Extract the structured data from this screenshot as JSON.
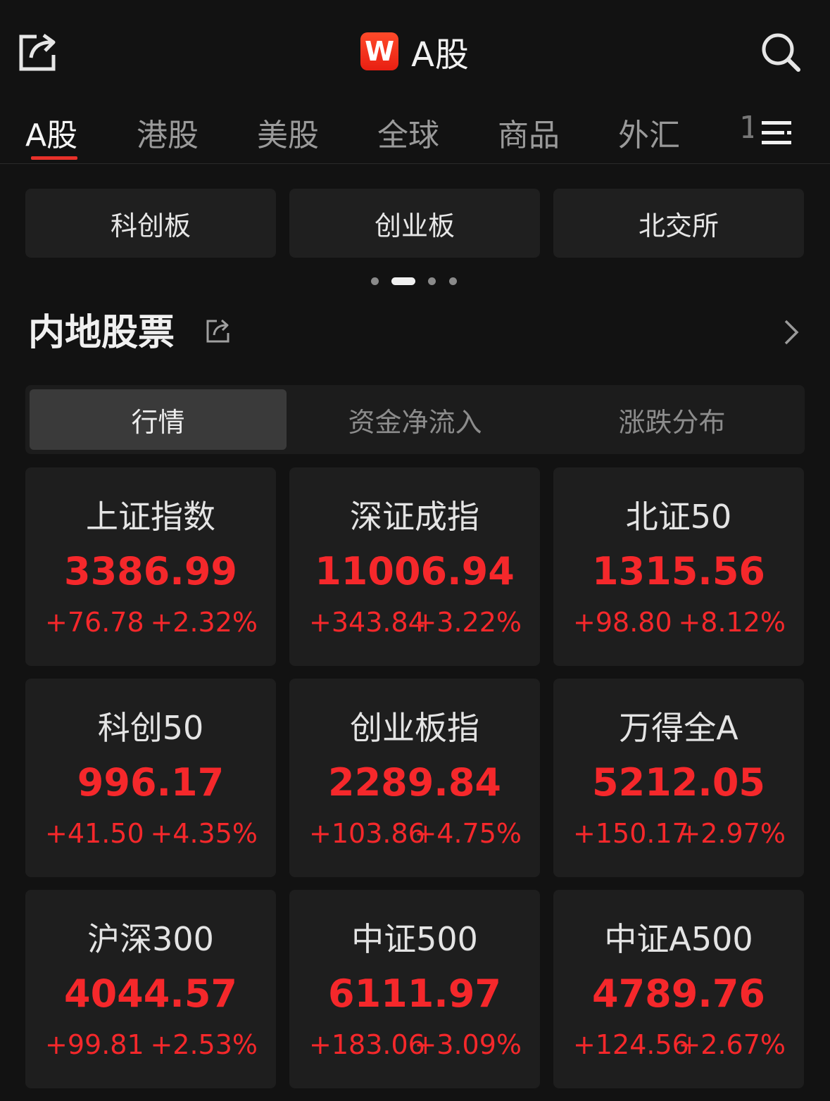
{
  "header": {
    "logo_letter": "W",
    "title": "A股"
  },
  "tabs": [
    {
      "label": "A股"
    },
    {
      "label": "港股"
    },
    {
      "label": "美股"
    },
    {
      "label": "全球"
    },
    {
      "label": "商品"
    },
    {
      "label": "外汇"
    }
  ],
  "tab_overflow": "1",
  "quick_boards": [
    {
      "label": "科创板"
    },
    {
      "label": "创业板"
    },
    {
      "label": "北交所"
    }
  ],
  "pager": {
    "count": 4,
    "active_index": 1
  },
  "section": {
    "title": "内地股票"
  },
  "segments": [
    {
      "label": "行情"
    },
    {
      "label": "资金净流入"
    },
    {
      "label": "涨跌分布"
    }
  ],
  "indices": [
    {
      "name": "上证指数",
      "value": "3386.99",
      "change": "+76.78",
      "pct": "+2.32%"
    },
    {
      "name": "深证成指",
      "value": "11006.94",
      "change": "+343.84",
      "pct": "+3.22%"
    },
    {
      "name": "北证50",
      "value": "1315.56",
      "change": "+98.80",
      "pct": "+8.12%"
    },
    {
      "name": "科创50",
      "value": "996.17",
      "change": "+41.50",
      "pct": "+4.35%"
    },
    {
      "name": "创业板指",
      "value": "2289.84",
      "change": "+103.86",
      "pct": "+4.75%"
    },
    {
      "name": "万得全A",
      "value": "5212.05",
      "change": "+150.17",
      "pct": "+2.97%"
    },
    {
      "name": "沪深300",
      "value": "4044.57",
      "change": "+99.81",
      "pct": "+2.53%"
    },
    {
      "name": "中证500",
      "value": "6111.97",
      "change": "+183.06",
      "pct": "+3.09%"
    },
    {
      "name": "中证A500",
      "value": "4789.76",
      "change": "+124.56",
      "pct": "+2.67%"
    }
  ],
  "colors": {
    "background": "#121212",
    "card": "#1e1e1e",
    "up_red": "#f5282b",
    "accent_underline": "#e8312a",
    "logo_red": "#e81f12"
  },
  "icons": {
    "share": "share-icon",
    "search": "search-icon",
    "menu": "menu-icon",
    "chevron": "chevron-right-icon"
  }
}
